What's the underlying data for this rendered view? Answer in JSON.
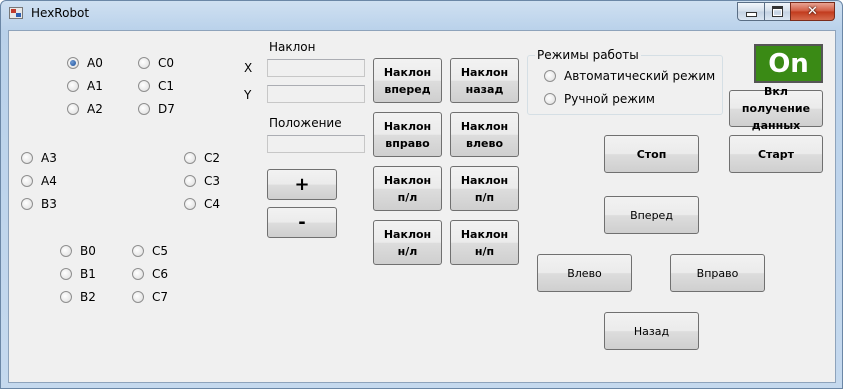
{
  "window": {
    "title": "HexRobot"
  },
  "radios_a": [
    {
      "label": "A0",
      "checked": true
    },
    {
      "label": "A1",
      "checked": false
    },
    {
      "label": "A2",
      "checked": false
    },
    {
      "label": "A3",
      "checked": false
    },
    {
      "label": "A4",
      "checked": false
    },
    {
      "label": "B3",
      "checked": false
    }
  ],
  "radios_c_top": [
    {
      "label": "C0",
      "checked": false
    },
    {
      "label": "C1",
      "checked": false
    },
    {
      "label": "D7",
      "checked": false
    }
  ],
  "radios_c_mid": [
    {
      "label": "C2",
      "checked": false
    },
    {
      "label": "C3",
      "checked": false
    },
    {
      "label": "C4",
      "checked": false
    }
  ],
  "radios_b": [
    {
      "label": "B0",
      "checked": false
    },
    {
      "label": "B1",
      "checked": false
    },
    {
      "label": "B2",
      "checked": false
    }
  ],
  "radios_c_bottom": [
    {
      "label": "C5",
      "checked": false
    },
    {
      "label": "C6",
      "checked": false
    },
    {
      "label": "C7",
      "checked": false
    }
  ],
  "tilt": {
    "label": "Наклон",
    "x_label": "X",
    "y_label": "Y",
    "x_value": "",
    "y_value": ""
  },
  "position": {
    "label": "Положение",
    "value": ""
  },
  "step_buttons": {
    "plus": "+",
    "minus": "-"
  },
  "tilt_buttons": [
    {
      "line1": "Наклон",
      "line2": "вперед"
    },
    {
      "line1": "Наклон",
      "line2": "назад"
    },
    {
      "line1": "Наклон",
      "line2": "вправо"
    },
    {
      "line1": "Наклон",
      "line2": "влево"
    },
    {
      "line1": "Наклон",
      "line2": "п/л"
    },
    {
      "line1": "Наклон",
      "line2": "п/п"
    },
    {
      "line1": "Наклон",
      "line2": "н/л"
    },
    {
      "line1": "Наклон",
      "line2": "н/п"
    }
  ],
  "modes": {
    "title": "Режимы работы",
    "options": [
      {
        "label": "Автоматический режим",
        "checked": false
      },
      {
        "label": "Ручной режим",
        "checked": false
      }
    ]
  },
  "indicator": {
    "text": "On",
    "color": "#3a8a15"
  },
  "control_buttons": {
    "enable_data_line1": "Вкл получение",
    "enable_data_line2": "данных",
    "stop": "Стоп",
    "start": "Старт",
    "forward": "Вперед",
    "left": "Влево",
    "right": "Вправо",
    "back": "Назад"
  }
}
